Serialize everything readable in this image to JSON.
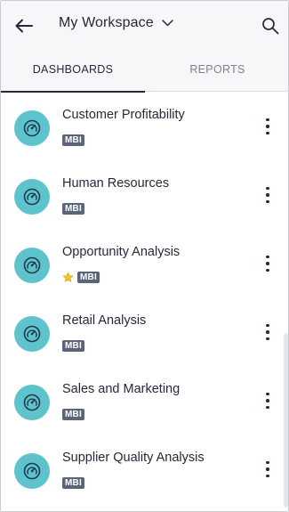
{
  "header": {
    "workspace_title": "My Workspace",
    "icons": {
      "back": "back-arrow-icon",
      "dropdown": "chevron-down-icon",
      "search": "search-icon"
    }
  },
  "tabs": [
    {
      "label": "DASHBOARDS",
      "active": true
    },
    {
      "label": "REPORTS",
      "active": false
    }
  ],
  "dashboards": [
    {
      "title": "Customer Profitability",
      "badge": "MBI",
      "favorite": false
    },
    {
      "title": "Human Resources",
      "badge": "MBI",
      "favorite": false
    },
    {
      "title": "Opportunity Analysis",
      "badge": "MBI",
      "favorite": true
    },
    {
      "title": "Retail Analysis",
      "badge": "MBI",
      "favorite": false
    },
    {
      "title": "Sales and Marketing",
      "badge": "MBI",
      "favorite": false
    },
    {
      "title": "Supplier Quality Analysis",
      "badge": "MBI",
      "favorite": false
    }
  ],
  "colors": {
    "accent": "#5ec3cd",
    "text": "#252a3a",
    "badge": "#5b6478",
    "star": "#f2c511",
    "header_bg": "#f7f7fa",
    "inactive_tab": "#7c8290"
  }
}
